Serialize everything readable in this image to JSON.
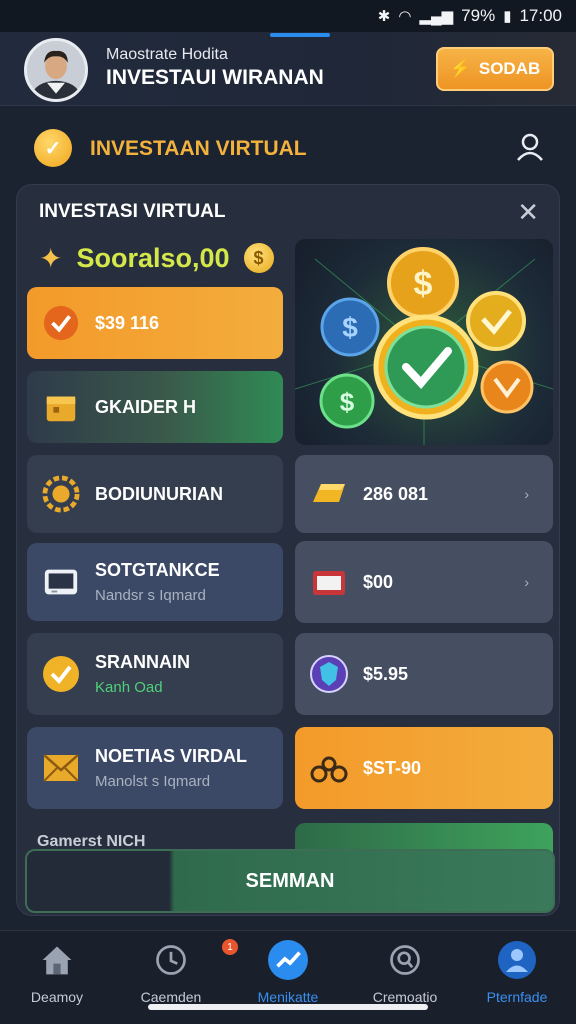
{
  "status_bar": {
    "battery": "79%",
    "time": "17:00"
  },
  "header": {
    "subtitle": "Maostrate Hodita",
    "title": "INVESTAUI WIRANAN",
    "action_button": "SODAB"
  },
  "section": {
    "title": "INVESTAAN VIRTUAL"
  },
  "card": {
    "title": "INVESTASI VIRTUAL",
    "balance": "Sooralso,00",
    "balance_coin": "$",
    "tiles_left": [
      {
        "label": "$39 116",
        "sub": "",
        "icon": "check-key-icon"
      },
      {
        "label": "GKAIDER H",
        "sub": "",
        "icon": "box-icon"
      },
      {
        "label": "BODIUNURIAN",
        "sub": "",
        "icon": "gear-coin-icon"
      },
      {
        "label": "SOTGTANKCE",
        "sub": "Nandsr s Iqmard",
        "icon": "tablet-icon"
      },
      {
        "label": "SRANNAIN",
        "sub": "Kanh Oad",
        "icon": "check-coin-icon"
      },
      {
        "label": "NOETIAS VIRDAL",
        "sub": "Manolst s Iqmard",
        "icon": "envelope-icon"
      }
    ],
    "tiles_right": [
      {
        "label": "286 081",
        "icon": "gold-bar-icon"
      },
      {
        "label": "$00",
        "icon": "wallet-icon"
      },
      {
        "label": "$5.95",
        "icon": "shield-coin-icon"
      },
      {
        "label": "$ST-90",
        "icon": "bike-icon"
      }
    ],
    "partial_label": "Gamerst NICH",
    "main_button": "SEMMAN"
  },
  "bottom_nav": [
    {
      "label": "Deamoy",
      "icon": "home-icon",
      "active": false
    },
    {
      "label": "Caemden",
      "icon": "clock-icon",
      "active": false
    },
    {
      "label": "Menikatte",
      "icon": "chart-icon",
      "active": true
    },
    {
      "label": "Cremoatio",
      "icon": "search-icon",
      "active": false
    },
    {
      "label": "Pternfade",
      "icon": "profile-icon",
      "active": false
    }
  ],
  "notification_badge": "1",
  "colors": {
    "accent_orange": "#f39a2a",
    "accent_blue": "#2b8cf0",
    "accent_green": "#3ea35c",
    "balance_text": "#d4e84a"
  }
}
